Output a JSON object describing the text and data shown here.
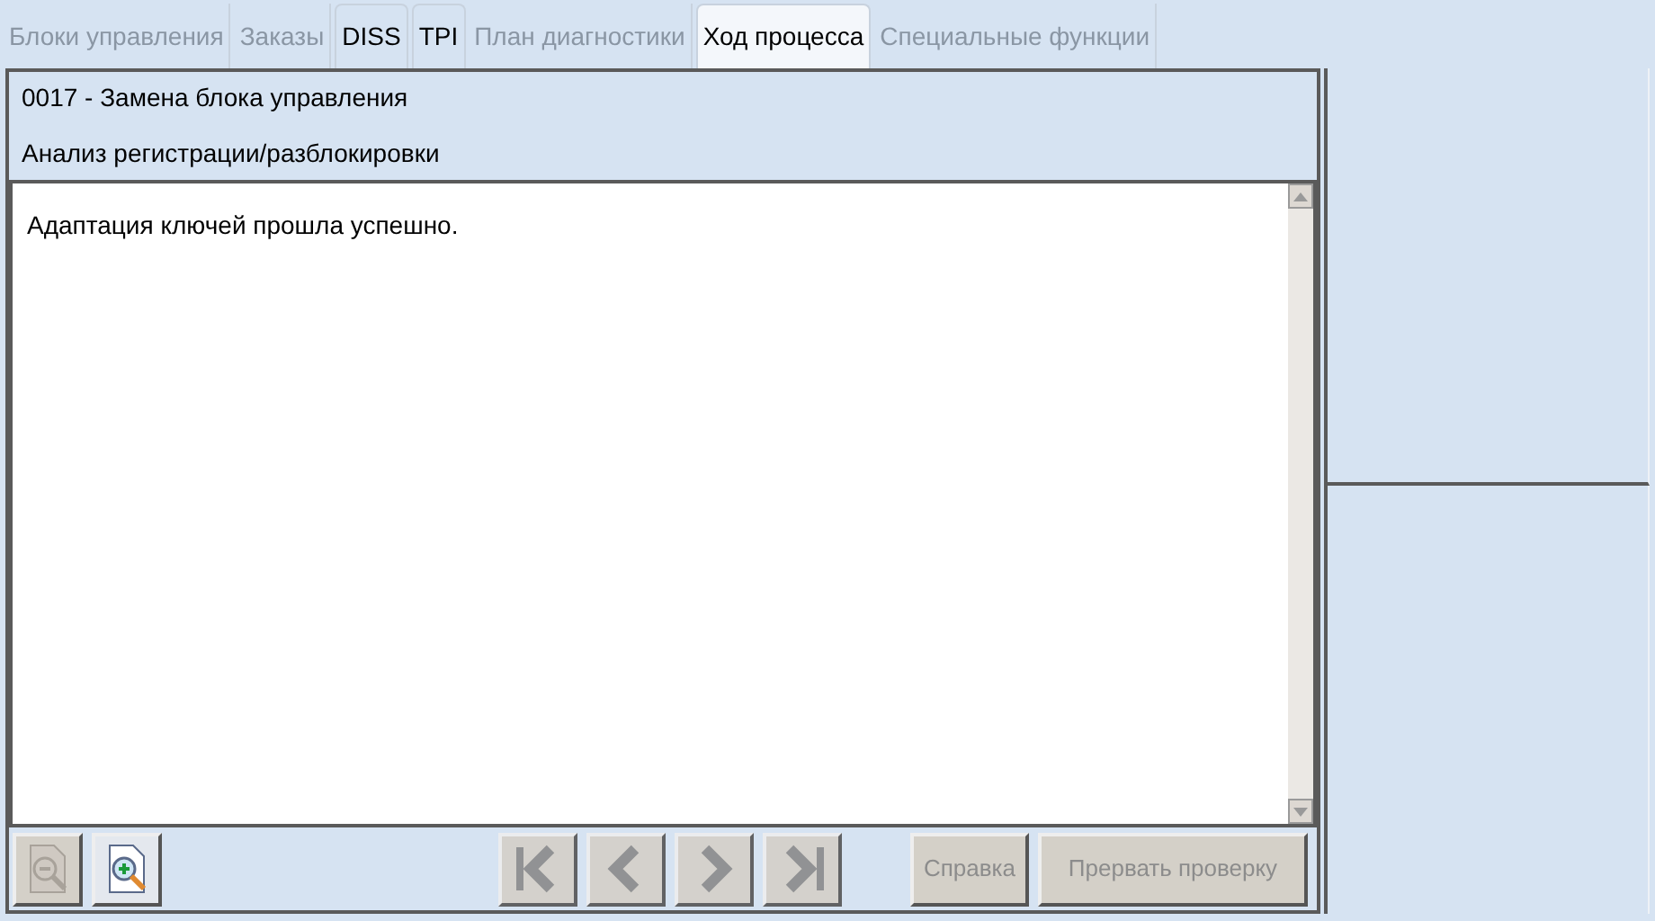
{
  "tabs": [
    {
      "label": "Блоки управления",
      "selected": false,
      "disabled": true
    },
    {
      "label": "Заказы",
      "selected": false,
      "disabled": true
    },
    {
      "label": "DISS",
      "selected": false,
      "disabled": false
    },
    {
      "label": "TPI",
      "selected": false,
      "disabled": false
    },
    {
      "label": "План диагностики",
      "selected": false,
      "disabled": true
    },
    {
      "label": "Ход процесса",
      "selected": true,
      "disabled": false
    },
    {
      "label": "Специальные функции",
      "selected": false,
      "disabled": true
    }
  ],
  "header": {
    "title": "0017 - Замена блока управления",
    "subtitle": "Анализ регистрации/разблокировки"
  },
  "message": "Адаптация ключей прошла успешно.",
  "zoom_buttons": [
    {
      "kind": "zoom-out",
      "disabled": true
    },
    {
      "kind": "zoom-in",
      "disabled": false
    }
  ],
  "nav_buttons": [
    {
      "kind": "first",
      "disabled": true
    },
    {
      "kind": "prev",
      "disabled": true
    },
    {
      "kind": "next",
      "disabled": true
    },
    {
      "kind": "last",
      "disabled": true
    }
  ],
  "action_buttons": [
    {
      "label": "Справка",
      "disabled": true
    },
    {
      "label": "Прервать проверку",
      "disabled": true
    }
  ]
}
